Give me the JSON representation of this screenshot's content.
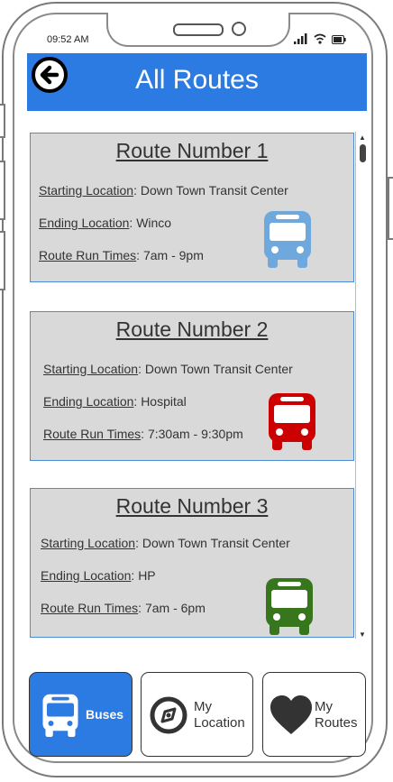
{
  "status_bar": {
    "time": "09:52 AM"
  },
  "header": {
    "title": "All Routes",
    "back_icon": "arrow-left-circle-icon"
  },
  "routes": [
    {
      "title": "Route Number 1",
      "start_label": "Starting Location",
      "start_value": ": Down Town Transit Center",
      "end_label": "Ending Location",
      "end_value": ": Winco",
      "times_label": "Route Run Times",
      "times_value": ": 7am - 9pm",
      "bus_color": "#6fa8dc"
    },
    {
      "title": "Route Number 2",
      "start_label": "Starting Location",
      "start_value": ": Down Town Transit Center",
      "end_label": "Ending Location",
      "end_value": ": Hospital",
      "times_label": "Route Run Times",
      "times_value": ": 7:30am - 9:30pm",
      "bus_color": "#cc0000"
    },
    {
      "title": "Route Number 3",
      "start_label": "Starting Location",
      "start_value": ": Down Town Transit Center",
      "end_label": "Ending Location",
      "end_value": ": HP",
      "times_label": "Route Run Times",
      "times_value": ": 7am - 6pm",
      "bus_color": "#38761d"
    }
  ],
  "nav": {
    "buses": {
      "label": "Buses",
      "icon": "bus-icon"
    },
    "my_location": {
      "label_line1": "My",
      "label_line2": "Location",
      "icon": "compass-icon"
    },
    "my_routes": {
      "label_line1": "My",
      "label_line2": "Routes",
      "icon": "heart-icon"
    }
  },
  "colors": {
    "accent": "#2b7be3",
    "card_bg": "#d9d9d9"
  }
}
